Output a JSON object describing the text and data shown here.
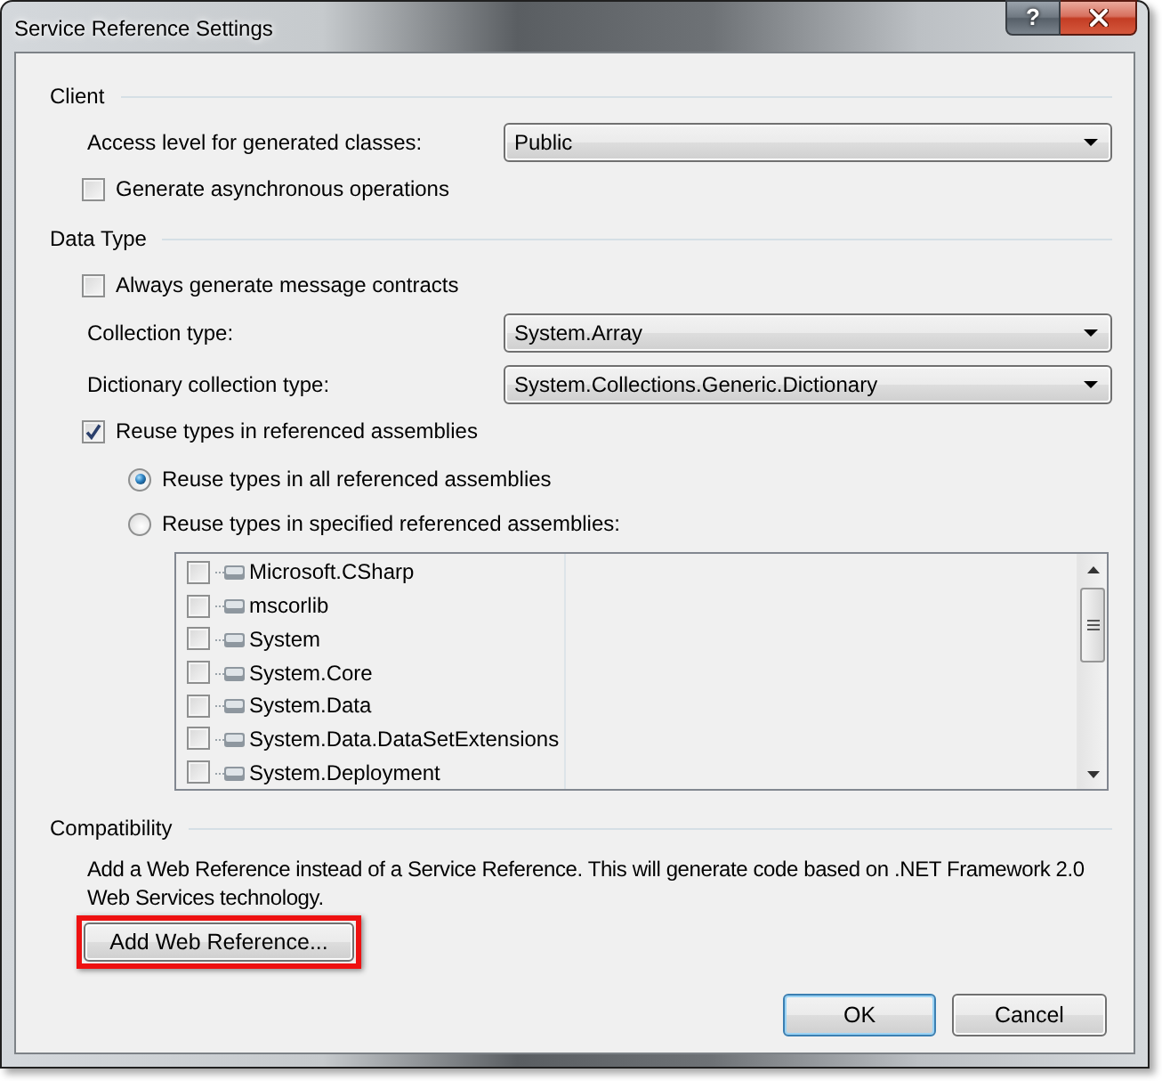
{
  "window": {
    "title": "Service Reference Settings",
    "help_button": "?"
  },
  "client": {
    "heading": "Client",
    "access_level": {
      "label": "Access level for generated classes:",
      "value": "Public"
    },
    "async_operations": {
      "label": "Generate asynchronous operations",
      "checked": false
    }
  },
  "data_type": {
    "heading": "Data Type",
    "message_contracts": {
      "label": "Always generate message contracts",
      "checked": false
    },
    "collection_type": {
      "label": "Collection type:",
      "value": "System.Array"
    },
    "dictionary_collection_type": {
      "label": "Dictionary collection type:",
      "value": "System.Collections.Generic.Dictionary"
    },
    "reuse_types": {
      "label": "Reuse types in referenced assemblies",
      "checked": true
    },
    "reuse_options": [
      {
        "label": "Reuse types in all referenced assemblies",
        "selected": true
      },
      {
        "label": "Reuse types in specified referenced assemblies:",
        "selected": false
      }
    ],
    "assemblies": [
      {
        "name": "Microsoft.CSharp",
        "checked": false
      },
      {
        "name": "mscorlib",
        "checked": false
      },
      {
        "name": "System",
        "checked": false
      },
      {
        "name": "System.Core",
        "checked": false
      },
      {
        "name": "System.Data",
        "checked": false
      },
      {
        "name": "System.Data.DataSetExtensions",
        "checked": false
      },
      {
        "name": "System.Deployment",
        "checked": false
      }
    ]
  },
  "compatibility": {
    "heading": "Compatibility",
    "description": "Add a Web Reference instead of a Service Reference. This will generate code based on .NET Framework 2.0 Web Services technology.",
    "button": {
      "label": "Add Web Reference...",
      "highlighted": true
    }
  },
  "buttons": [
    {
      "label": "OK",
      "default": true
    },
    {
      "label": "Cancel",
      "default": false
    }
  ]
}
